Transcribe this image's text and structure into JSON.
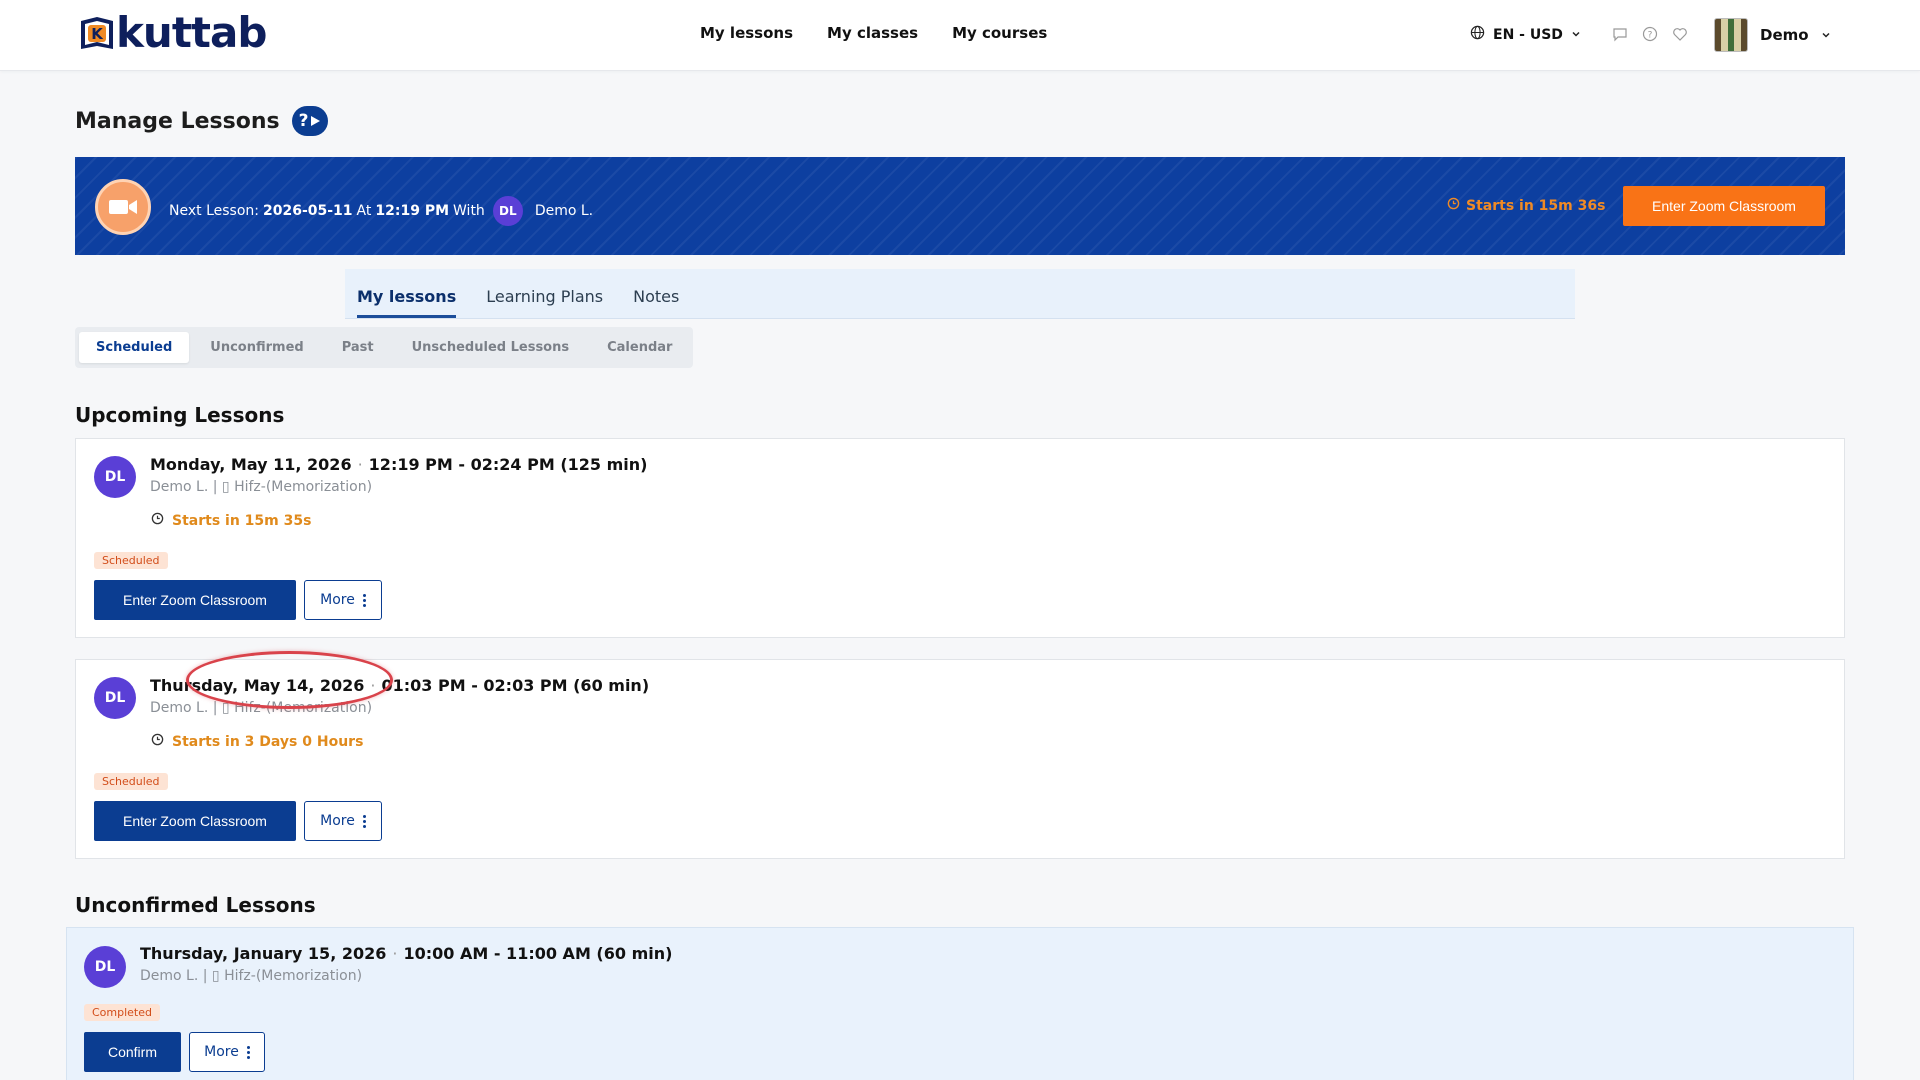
{
  "header": {
    "logo_text": "kuttab",
    "nav": [
      "My lessons",
      "My classes",
      "My courses"
    ],
    "lang": "EN - USD",
    "user_name": "Demo"
  },
  "page": {
    "title": "Manage Lessons",
    "help_label": "?"
  },
  "banner": {
    "prefix": "Next Lesson:",
    "date": "2026-05-11",
    "at": "At",
    "time": "12:19 PM",
    "with": "With",
    "initials": "DL",
    "teacher": "Demo L.",
    "starts_in": "Starts in 15m 36s",
    "button": "Enter Zoom Classroom"
  },
  "main_tabs": [
    "My lessons",
    "Learning Plans",
    "Notes"
  ],
  "sub_tabs": [
    "Scheduled",
    "Unconfirmed",
    "Past",
    "Unscheduled Lessons",
    "Calendar"
  ],
  "sections": {
    "upcoming": "Upcoming Lessons",
    "unconfirmed": "Unconfirmed Lessons"
  },
  "lessons": [
    {
      "initials": "DL",
      "date": "Monday, May 11, 2026",
      "time": "12:19 PM - 02:24 PM (125 min)",
      "sub": "Demo L. | ▯ Hifz-(Memorization)",
      "starts": "Starts in 15m 35s",
      "badge": "Scheduled",
      "primary": "Enter Zoom Classroom",
      "more": "More"
    },
    {
      "initials": "DL",
      "date": "Thursday, May 14, 2026",
      "time": "01:03 PM - 02:03 PM (60 min)",
      "sub": "Demo L. | ▯ Hifz-(Memorization)",
      "starts": "Starts in 3 Days 0 Hours",
      "badge": "Scheduled",
      "primary": "Enter Zoom Classroom",
      "more": "More"
    },
    {
      "initials": "DL",
      "date": "Thursday, January 15, 2026",
      "time": "10:00 AM - 11:00 AM (60 min)",
      "sub": "Demo L. | ▯ Hifz-(Memorization)",
      "badge": "Completed",
      "primary": "Confirm",
      "more": "More"
    }
  ],
  "colors": {
    "brand_blue": "#0b3d91",
    "banner_blue": "#0d3fa0",
    "accent_orange": "#f97316",
    "avatar_purple": "#5a3fd6"
  }
}
